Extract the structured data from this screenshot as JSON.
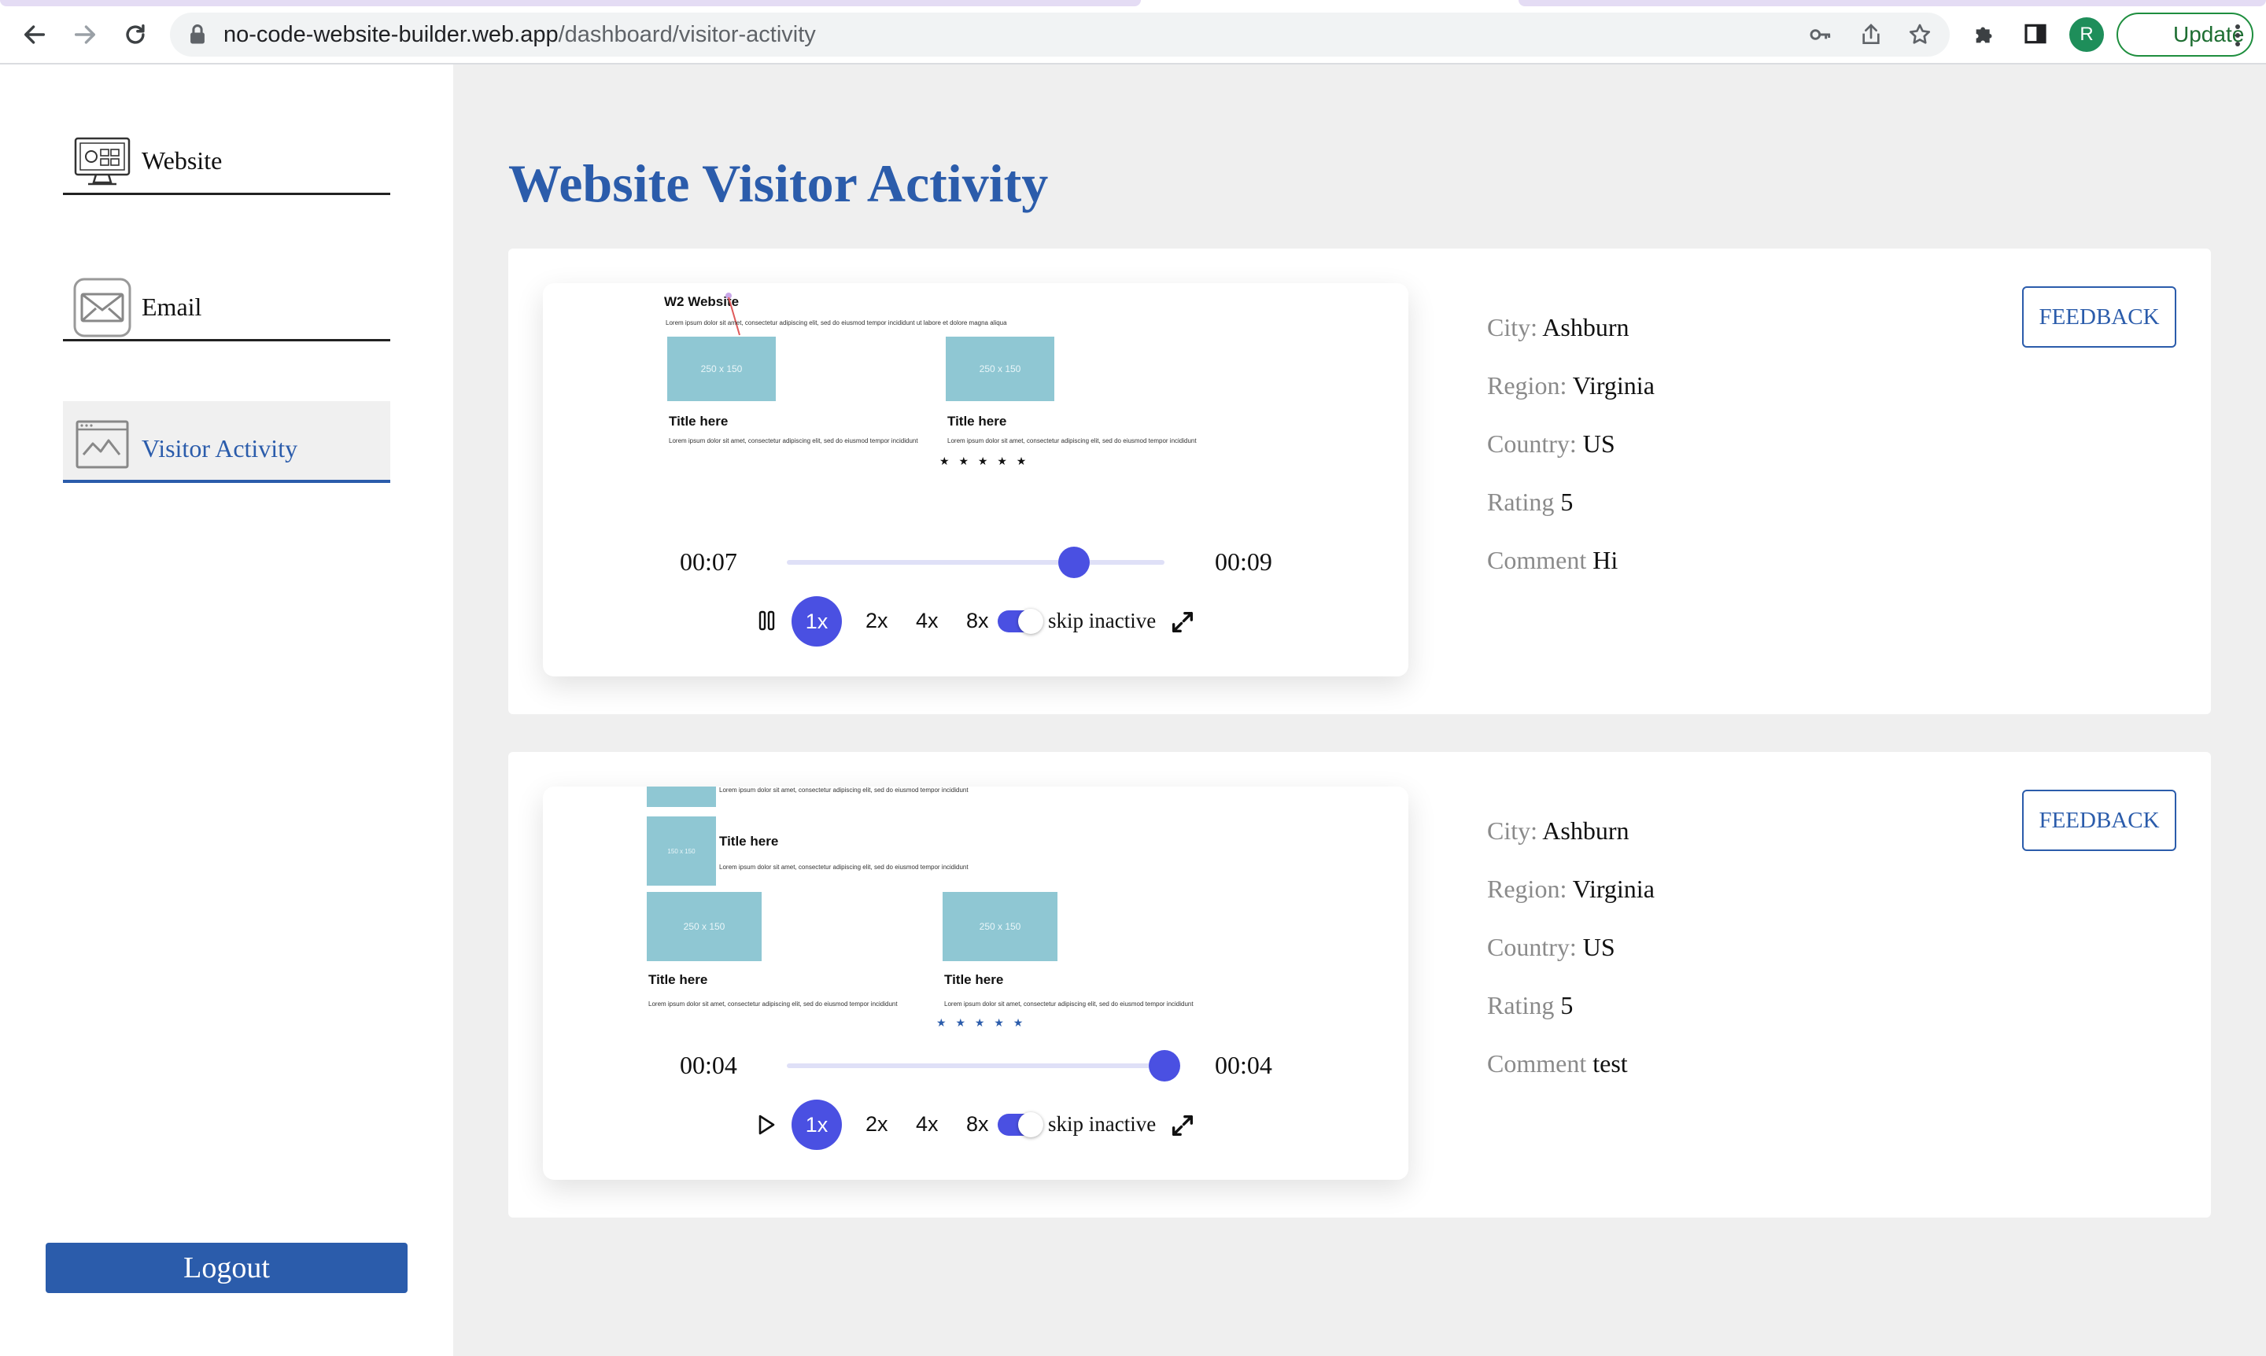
{
  "browser": {
    "url_host": "no-code-website-builder.web.app",
    "url_path": "/dashboard/visitor-activity",
    "profile_initial": "R",
    "update_label": "Update"
  },
  "sidebar": {
    "items": [
      {
        "label": "Website",
        "icon": "website-builder-icon",
        "active": false
      },
      {
        "label": "Email",
        "icon": "envelope-icon",
        "active": false
      },
      {
        "label": "Visitor Activity",
        "icon": "activity-chart-icon",
        "active": true
      }
    ],
    "logout_label": "Logout"
  },
  "main": {
    "title": "Website Visitor Activity",
    "sessions": [
      {
        "preview": {
          "site_title": "W2 Website",
          "intro_text": "Lorem ipsum dolor sit amet, consectetur adipiscing elit, sed do eiusmod tempor incididunt ut labore et dolore magna aliqua",
          "placeholder_label": "250 x 150",
          "card_title": "Title here",
          "card_text": "Lorem ipsum dolor sit amet, consectetur adipiscing elit, sed do eiusmod tempor incididunt",
          "stars": "★ ★ ★ ★ ★"
        },
        "player": {
          "current_time": "00:07",
          "total_time": "00:09",
          "progress": 0.76,
          "state": "playing",
          "speeds": [
            "1x",
            "2x",
            "4x",
            "8x"
          ],
          "active_speed": "1x",
          "skip_inactive_label": "skip inactive",
          "skip_inactive": true
        },
        "details": {
          "city_label": "City:",
          "city": "Ashburn",
          "region_label": "Region:",
          "region": "Virginia",
          "country_label": "Country:",
          "country": "US",
          "rating_label": "Rating",
          "rating": "5",
          "comment_label": "Comment",
          "comment": "Hi"
        },
        "feedback_label": "FEEDBACK"
      },
      {
        "preview": {
          "top_text": "Lorem ipsum dolor sit amet, consectetur adipiscing elit, sed do eiusmod tempor incididunt",
          "small_placeholder_label": "150 x 150",
          "side_title": "Title here",
          "side_text": "Lorem ipsum dolor sit amet, consectetur adipiscing elit, sed do eiusmod tempor incididunt",
          "placeholder_label": "250 x 150",
          "card_title": "Title here",
          "card_text": "Lorem ipsum dolor sit amet, consectetur adipiscing elit, sed do eiusmod tempor incididunt",
          "stars": "★ ★ ★ ★ ★"
        },
        "player": {
          "current_time": "00:04",
          "total_time": "00:04",
          "progress": 1.0,
          "state": "paused",
          "speeds": [
            "1x",
            "2x",
            "4x",
            "8x"
          ],
          "active_speed": "1x",
          "skip_inactive_label": "skip inactive",
          "skip_inactive": true
        },
        "details": {
          "city_label": "City:",
          "city": "Ashburn",
          "region_label": "Region:",
          "region": "Virginia",
          "country_label": "Country:",
          "country": "US",
          "rating_label": "Rating",
          "rating": "5",
          "comment_label": "Comment",
          "comment": "test"
        },
        "feedback_label": "FEEDBACK"
      }
    ]
  },
  "colors": {
    "brand_blue": "#2b5cab",
    "player_accent": "#4a50e2",
    "placeholder": "#8fc7d3"
  }
}
